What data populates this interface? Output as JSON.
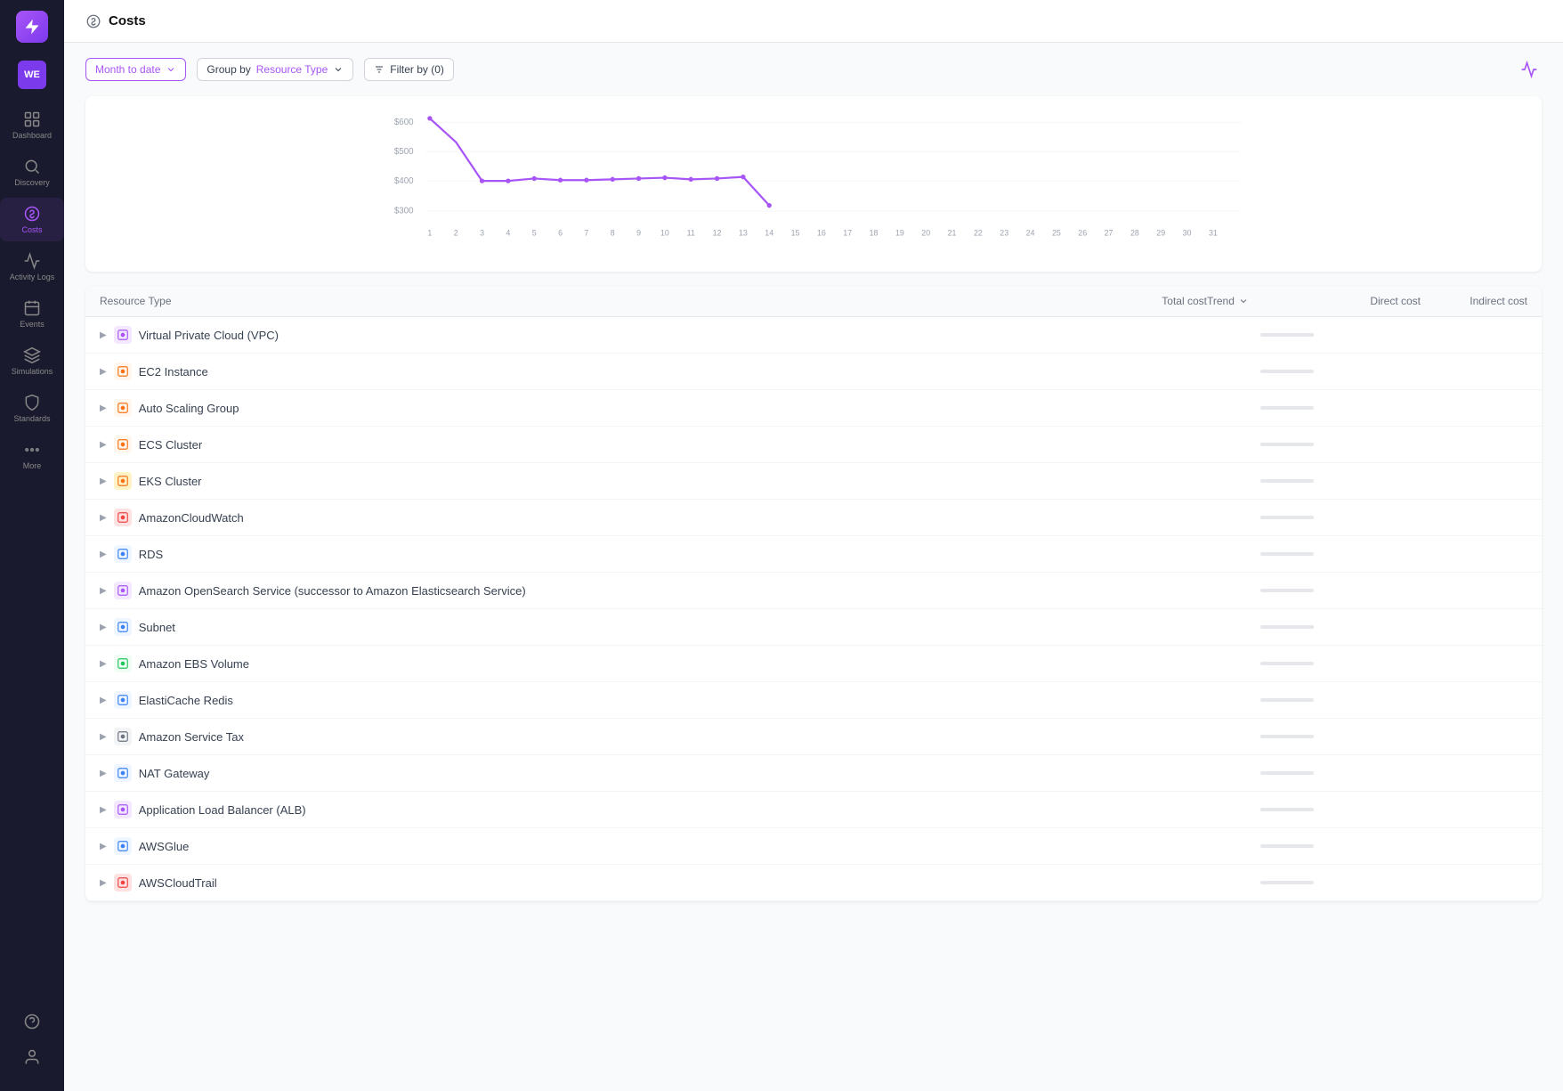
{
  "app": {
    "title": "Costs"
  },
  "user": {
    "initials": "WE"
  },
  "sidebar": {
    "items": [
      {
        "id": "dashboard",
        "label": "Dashboard",
        "active": false
      },
      {
        "id": "discovery",
        "label": "Discovery",
        "active": false
      },
      {
        "id": "costs",
        "label": "Costs",
        "active": true
      },
      {
        "id": "activity-logs",
        "label": "Activity Logs",
        "active": false
      },
      {
        "id": "events",
        "label": "Events",
        "active": false
      },
      {
        "id": "simulations",
        "label": "Simulations",
        "active": false
      },
      {
        "id": "standards",
        "label": "Standards",
        "active": false
      },
      {
        "id": "more",
        "label": "More",
        "active": false
      }
    ]
  },
  "toolbar": {
    "date_filter": "Month to date",
    "group_by_label": "Group by",
    "group_by_value": "Resource Type",
    "filter_label": "Filter by (0)"
  },
  "chart": {
    "y_labels": [
      "$600",
      "$500",
      "$400",
      "$300"
    ],
    "x_labels": [
      "1",
      "2",
      "3",
      "4",
      "5",
      "6",
      "7",
      "8",
      "9",
      "10",
      "11",
      "12",
      "13",
      "14",
      "15",
      "16",
      "17",
      "18",
      "19",
      "20",
      "21",
      "22",
      "23",
      "24",
      "25",
      "26",
      "27",
      "28",
      "29",
      "30",
      "31"
    ]
  },
  "table": {
    "columns": [
      "Resource Type",
      "Total cost",
      "Trend",
      "Direct cost",
      "Indirect cost"
    ],
    "rows": [
      {
        "name": "Virtual Private Cloud (VPC)",
        "icon_color": "#a855f7",
        "icon_bg": "#f3e8ff"
      },
      {
        "name": "EC2 Instance",
        "icon_color": "#f97316",
        "icon_bg": "#fff7ed"
      },
      {
        "name": "Auto Scaling Group",
        "icon_color": "#f97316",
        "icon_bg": "#fff7ed"
      },
      {
        "name": "ECS Cluster",
        "icon_color": "#f97316",
        "icon_bg": "#fff7ed"
      },
      {
        "name": "EKS Cluster",
        "icon_color": "#f97316",
        "icon_bg": "#fef3c7"
      },
      {
        "name": "AmazonCloudWatch",
        "icon_color": "#ef4444",
        "icon_bg": "#fee2e2"
      },
      {
        "name": "RDS",
        "icon_color": "#3b82f6",
        "icon_bg": "#eff6ff"
      },
      {
        "name": "Amazon OpenSearch Service (successor to Amazon Elasticsearch Service)",
        "icon_color": "#a855f7",
        "icon_bg": "#f3e8ff"
      },
      {
        "name": "Subnet",
        "icon_color": "#3b82f6",
        "icon_bg": "#eff6ff"
      },
      {
        "name": "Amazon EBS Volume",
        "icon_color": "#22c55e",
        "icon_bg": "#f0fdf4"
      },
      {
        "name": "ElastiCache Redis",
        "icon_color": "#3b82f6",
        "icon_bg": "#eff6ff"
      },
      {
        "name": "Amazon Service Tax",
        "icon_color": "#6b7280",
        "icon_bg": "#f3f4f6"
      },
      {
        "name": "NAT Gateway",
        "icon_color": "#3b82f6",
        "icon_bg": "#eff6ff"
      },
      {
        "name": "Application Load Balancer (ALB)",
        "icon_color": "#a855f7",
        "icon_bg": "#f3e8ff"
      },
      {
        "name": "AWSGlue",
        "icon_color": "#3b82f6",
        "icon_bg": "#eff6ff"
      },
      {
        "name": "AWSCloudTrail",
        "icon_color": "#ef4444",
        "icon_bg": "#fee2e2"
      }
    ]
  }
}
